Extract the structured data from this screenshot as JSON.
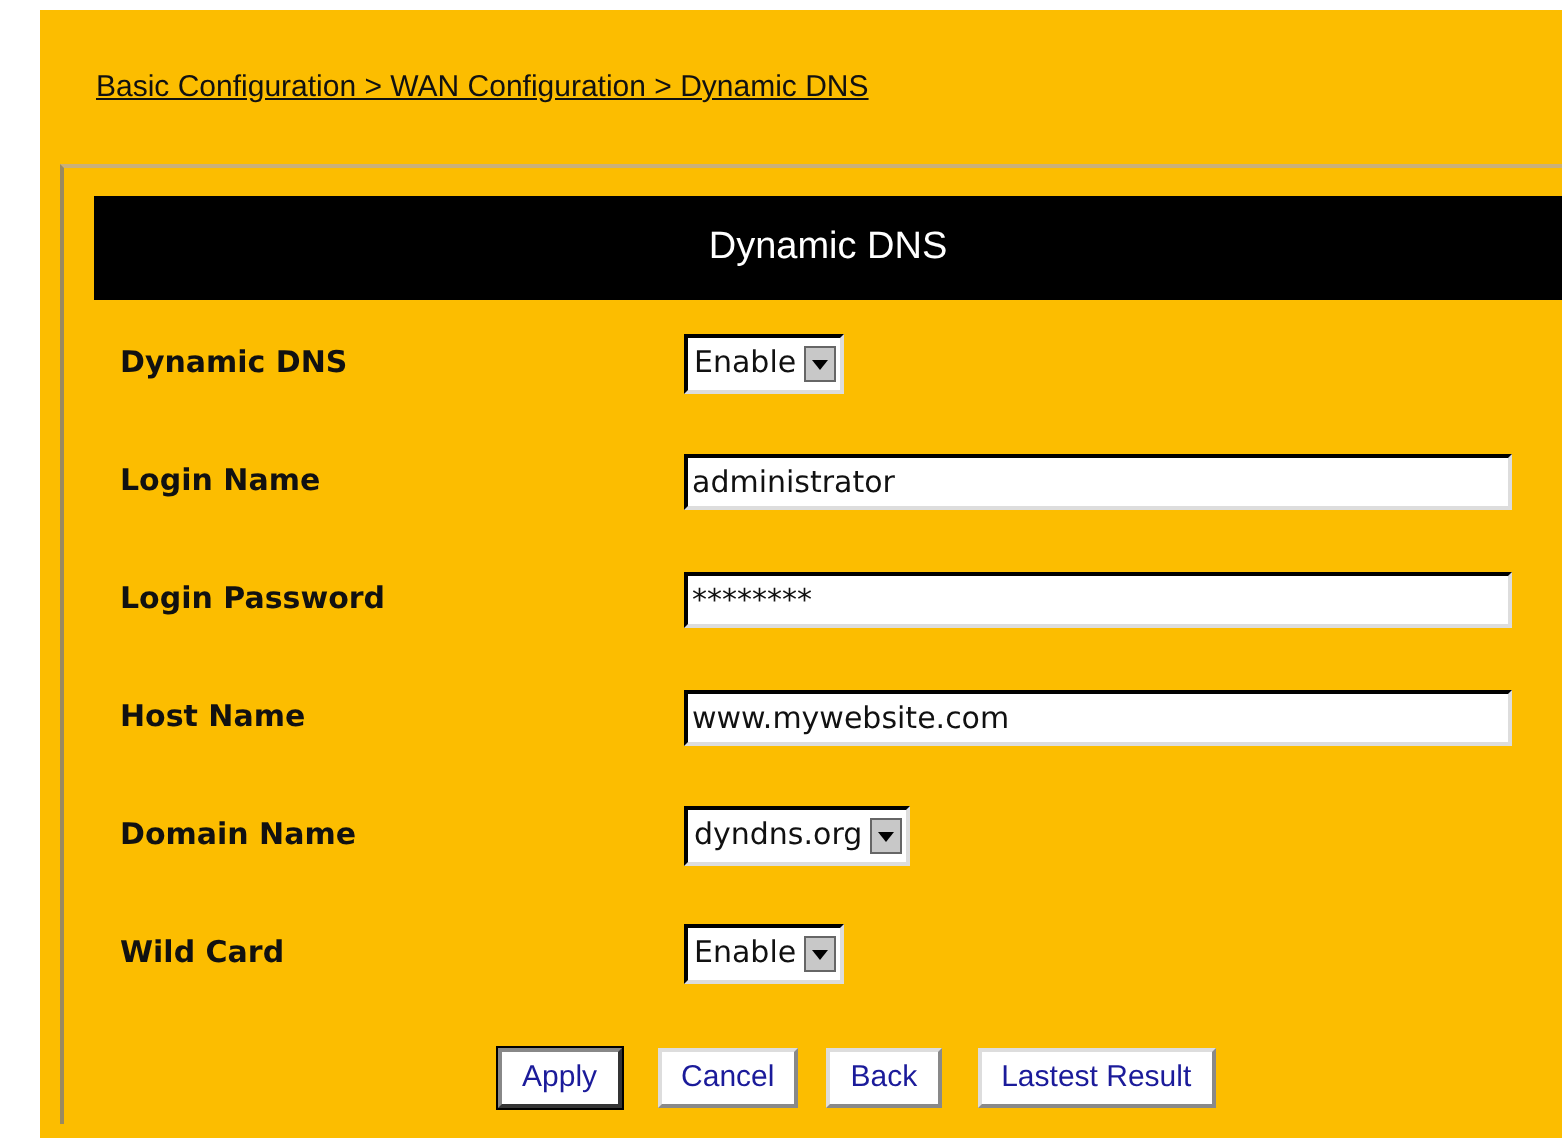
{
  "breadcrumb": "Basic Configuration > WAN Configuration > Dynamic DNS",
  "panel": {
    "title": "Dynamic DNS"
  },
  "fields": [
    {
      "label": "Dynamic DNS",
      "kind": "select",
      "value": "Enable"
    },
    {
      "label": "Login Name",
      "kind": "text",
      "value": "administrator"
    },
    {
      "label": "Login Password",
      "kind": "text",
      "value": "********"
    },
    {
      "label": "Host Name",
      "kind": "text",
      "value": "www.mywebsite.com"
    },
    {
      "label": "Domain Name",
      "kind": "select",
      "value": "dyndns.org"
    },
    {
      "label": "Wild Card",
      "kind": "select",
      "value": "Enable"
    }
  ],
  "buttons": [
    {
      "label": "Apply",
      "default": true
    },
    {
      "label": "Cancel",
      "default": false
    },
    {
      "label": "Back",
      "default": false
    },
    {
      "label": "Lastest Result",
      "default": false
    }
  ]
}
